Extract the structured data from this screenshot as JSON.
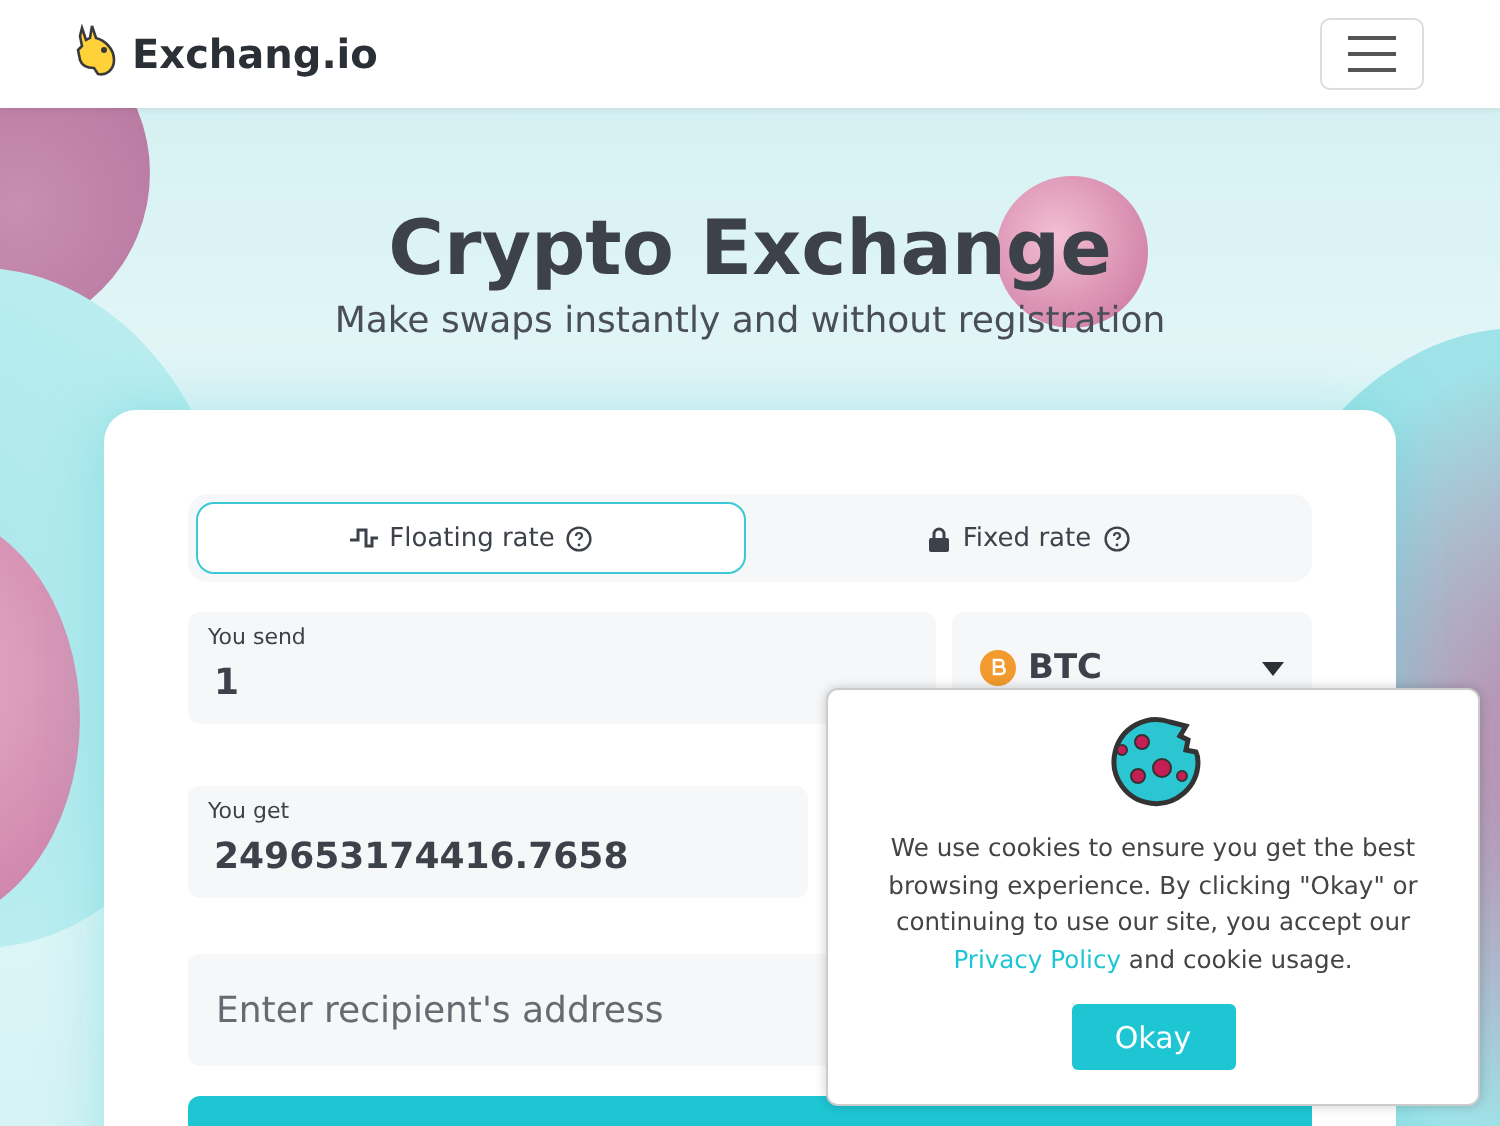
{
  "header": {
    "brand": "Exchang.io"
  },
  "hero": {
    "title": "Crypto Exchange",
    "subtitle": "Make swaps instantly and without registration"
  },
  "rate_tabs": [
    {
      "label": "Floating rate",
      "kind": "floating",
      "selected": true
    },
    {
      "label": "Fixed rate",
      "kind": "fixed",
      "selected": false
    }
  ],
  "send": {
    "label": "You send",
    "value": "1",
    "currency": "BTC"
  },
  "get": {
    "label": "You get",
    "value": "249653174416.7658"
  },
  "address": {
    "placeholder": "Enter recipient's address"
  },
  "cookie_notice": {
    "text": "We use cookies to ensure you get the best browsing experience. By clicking \"Okay\" or continuing to use our site, you accept our",
    "link": "Privacy Policy",
    "text_after": "and cookie usage.",
    "button": "Okay"
  }
}
